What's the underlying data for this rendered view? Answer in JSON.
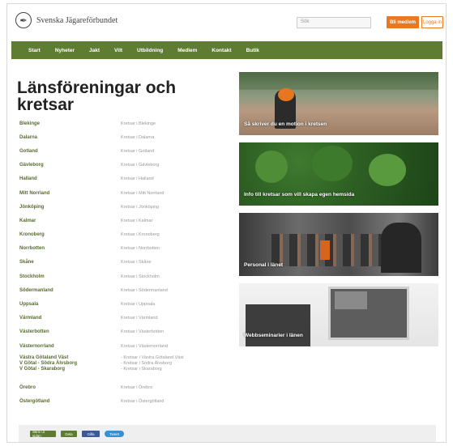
{
  "header": {
    "logo_text": "Svenska Jägareförbundet",
    "search_placeholder": "Sök",
    "member_button": "Bli medlem",
    "login_button": "Logga in"
  },
  "nav": {
    "items": [
      "Start",
      "Nyheter",
      "Jakt",
      "Vilt",
      "Utbildning",
      "Medlem",
      "Kontakt",
      "Butik"
    ]
  },
  "main": {
    "title": "Länsföreningar och kretsar",
    "rows": [
      {
        "name": "Blekinge",
        "link": "Kretsar i Blekinge"
      },
      {
        "name": "Dalarna",
        "link": "Kretsar i Dalarna"
      },
      {
        "name": "Gotland",
        "link": "Kretsar i Gotland"
      },
      {
        "name": "Gävleborg",
        "link": "Kretsar i Gävleborg"
      },
      {
        "name": "Halland",
        "link": "Kretsar i Halland"
      },
      {
        "name": "Mitt Norrland",
        "link": "Kretsar i Mitt Norrland"
      },
      {
        "name": "Jönköping",
        "link": "Kretsar i Jönköping"
      },
      {
        "name": "Kalmar",
        "link": "Kretsar i Kalmar"
      },
      {
        "name": "Kronoberg",
        "link": "Kretsar i Kronoberg"
      },
      {
        "name": "Norrbotten",
        "link": "Kretsar i Norrbotten"
      },
      {
        "name": "Skåne",
        "link": "Kretsar i Skåne"
      },
      {
        "name": "Stockholm",
        "link": "Kretsar i Stockholm"
      },
      {
        "name": "Södermanland",
        "link": "Kretsar i Södermanland"
      },
      {
        "name": "Uppsala",
        "link": "Kretsar i Uppsala"
      },
      {
        "name": "Värmland",
        "link": "Kretsar i Värmland"
      },
      {
        "name": "Västerbotten",
        "link": "Kretsar i Västerbotten"
      },
      {
        "name": "Västernorrland",
        "link": "Kretsar i Västernorrland"
      }
    ],
    "vg_row": {
      "names": [
        "Västra Götaland Väst",
        "V Götal - Södra Älvsborg",
        "V Götal - Skaraborg"
      ],
      "links": [
        "- Kretsar i Västra Götaland Väst",
        "- Kretsar i Södra Älvsborg",
        "- Kretsar i Skaraborg"
      ]
    },
    "rows_after": [
      {
        "name": "Örebro",
        "link": "Kretsar i Örebro"
      },
      {
        "name": "Östergötland",
        "link": "Kretsar i Östergötland"
      }
    ]
  },
  "cards": [
    {
      "caption": "Så skriver du en motion i kretsen"
    },
    {
      "caption": "Info till kretsar som vill skapa egen hemsida"
    },
    {
      "caption": "Personal i länet"
    },
    {
      "caption": "Webbseminarier i länen"
    }
  ],
  "footer": {
    "buttons": [
      "Skriv ut sidan",
      "Dela",
      "Gilla",
      "Tweet"
    ]
  }
}
